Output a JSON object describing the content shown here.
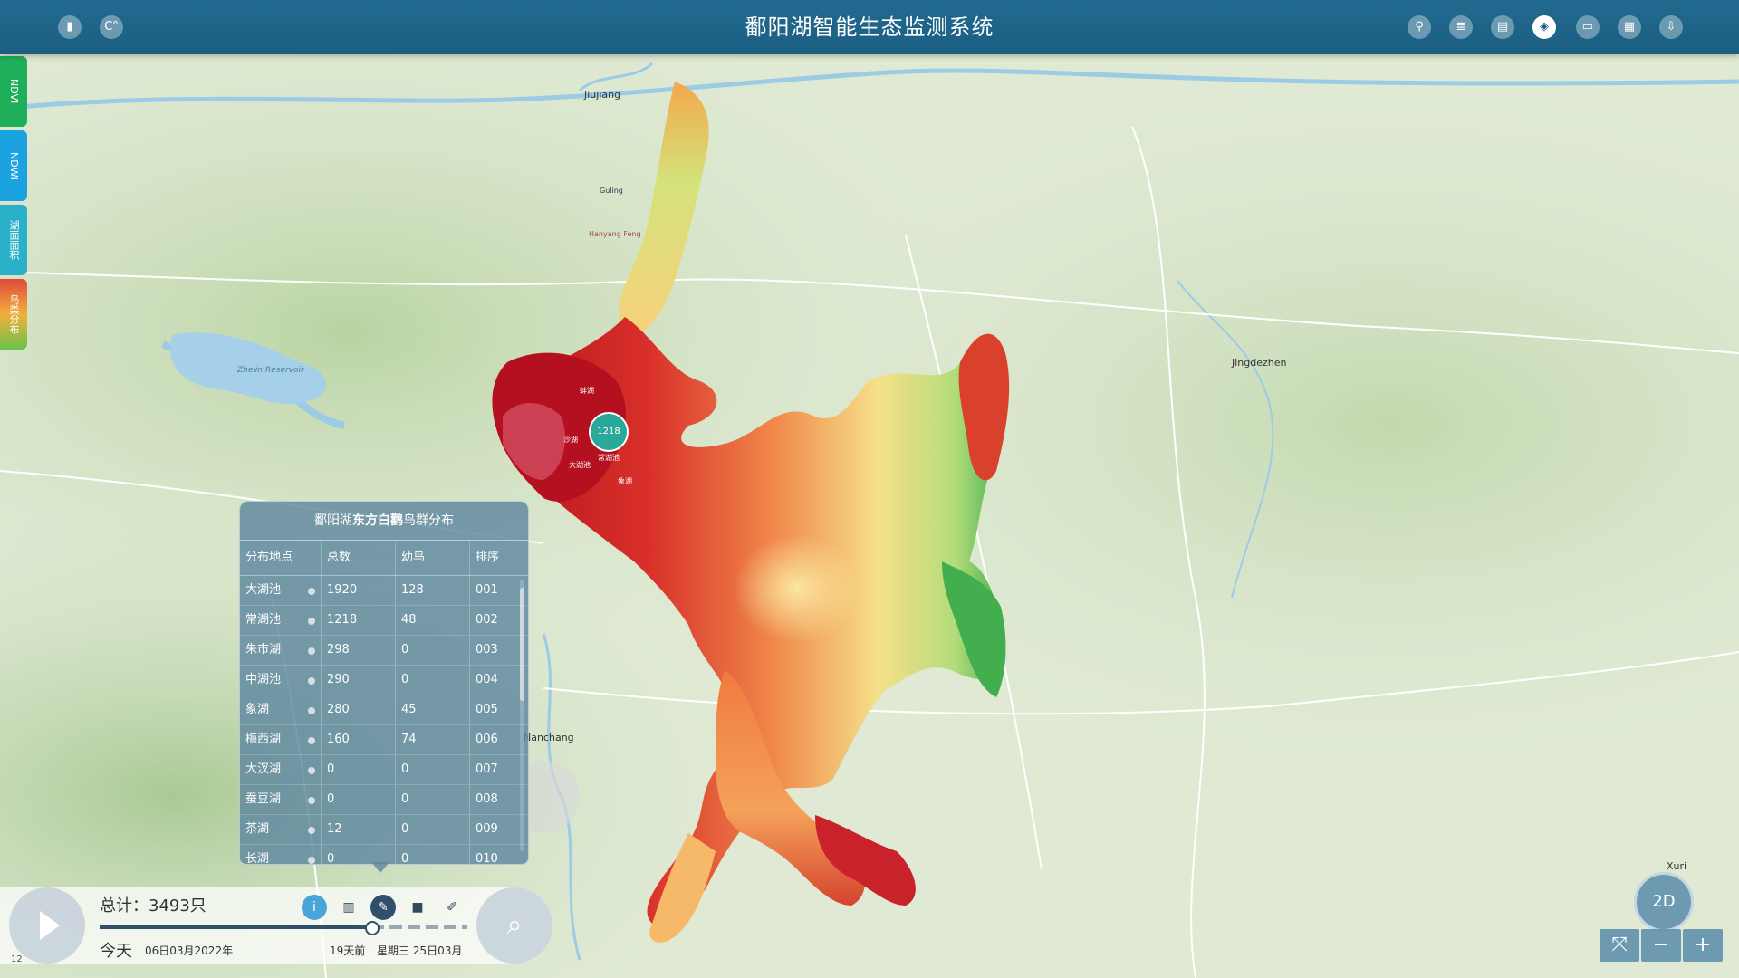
{
  "header": {
    "title": "鄱阳湖智能生态监测系统",
    "left_icons": [
      "document-icon",
      "temperature-icon"
    ],
    "left_icon_glyphs": [
      "▮",
      "C°"
    ],
    "right_icons": [
      "location-icon",
      "database-icon",
      "report-icon",
      "layers-icon",
      "monitor-icon",
      "chat-icon",
      "download-icon"
    ],
    "right_icon_glyphs": [
      "⚲",
      "≣",
      "▤",
      "◈",
      "▭",
      "▦",
      "⇩"
    ],
    "active_right_index": 3
  },
  "left_tabs": [
    {
      "label": "NDVI",
      "color": "#1fae5a"
    },
    {
      "label": "NDWI",
      "color": "#1aa3e0"
    },
    {
      "label": "湖面面积",
      "color": "#2ab0c8"
    },
    {
      "label": "鸟类分布",
      "color": "#e04a3a"
    }
  ],
  "map": {
    "cities": [
      {
        "name": "Jiujiang"
      },
      {
        "name": "Jingdezhen"
      },
      {
        "name": "Nanchang"
      },
      {
        "name": "Zhelin Reservoir"
      },
      {
        "name": "Xuri"
      },
      {
        "name": "Hanyang Feng"
      },
      {
        "name": "Guling"
      }
    ],
    "bird_markers": [
      {
        "label": "蚌湖"
      },
      {
        "label": "沙湖"
      },
      {
        "label": "大湖池"
      },
      {
        "label": "常湖池"
      },
      {
        "label": "象湖"
      }
    ],
    "cluster_count": "1218"
  },
  "panel": {
    "title_prefix": "鄱阳湖",
    "title_bold": "东方白鹳",
    "title_suffix": "鸟群分布",
    "columns": [
      "分布地点",
      "总数",
      "幼鸟",
      "排序"
    ],
    "rows": [
      [
        "大湖池",
        "1920",
        "128",
        "001"
      ],
      [
        "常湖池",
        "1218",
        "48",
        "002"
      ],
      [
        "朱市湖",
        "298",
        "0",
        "003"
      ],
      [
        "中湖池",
        "290",
        "0",
        "004"
      ],
      [
        "象湖",
        "280",
        "45",
        "005"
      ],
      [
        "梅西湖",
        "160",
        "74",
        "006"
      ],
      [
        "大汊湖",
        "0",
        "0",
        "007"
      ],
      [
        "蚕豆湖",
        "0",
        "0",
        "008"
      ],
      [
        "茶湖",
        "12",
        "0",
        "009"
      ],
      [
        "长湖",
        "0",
        "0",
        "010"
      ]
    ]
  },
  "timeline": {
    "total_label": "总计：3493只",
    "today_label": "今天",
    "start_date": "06日03月2022年",
    "ago_label": "19天前",
    "current_date": "星期三 25日03月",
    "progress": 0.74,
    "icons": [
      "info-icon",
      "trash-icon",
      "edit-icon",
      "stop-icon",
      "bookmark-icon"
    ],
    "icon_glyphs": [
      "i",
      "▥",
      "✎",
      "■",
      "✐"
    ]
  },
  "controls": {
    "view_mode": "2D",
    "zoom_out": "−",
    "zoom_in": "+",
    "fullscreen_glyph": "⤧"
  },
  "footer": {
    "scale_label": "12"
  }
}
